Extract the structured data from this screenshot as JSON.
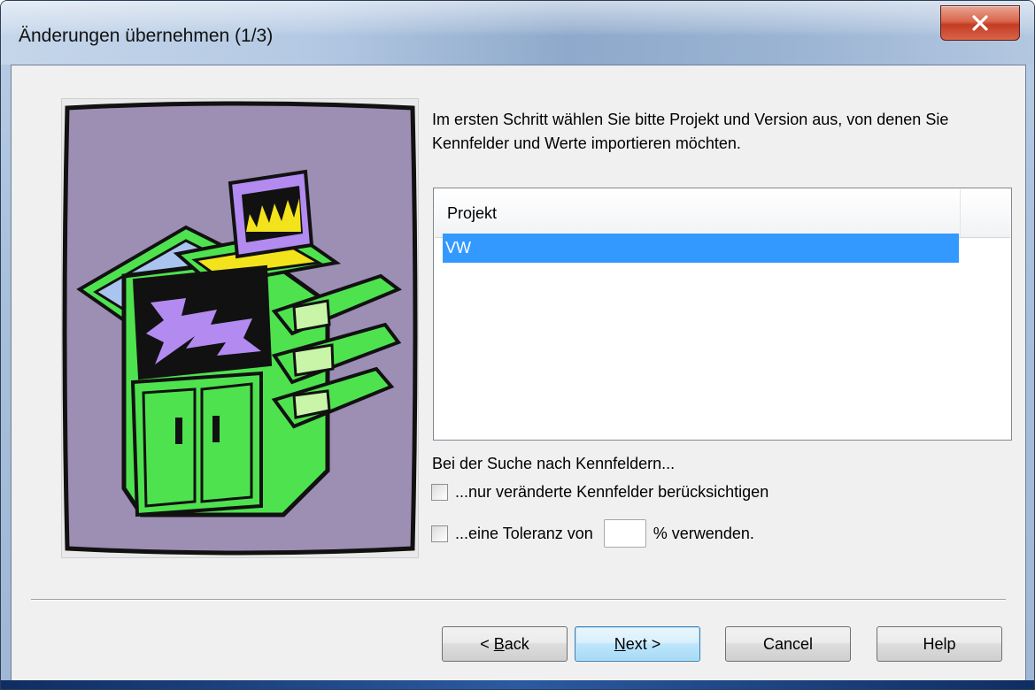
{
  "window": {
    "title": "Änderungen übernehmen (1/3)",
    "close_glyph": "x"
  },
  "instruction": "Im ersten Schritt wählen Sie bitte Projekt und Version aus, von denen Sie Kennfelder und Werte importieren möchten.",
  "project_list": {
    "column_header": "Projekt",
    "rows": [
      "VW"
    ],
    "selected_index": 0
  },
  "search": {
    "label": "Bei der Suche nach Kennfeldern...",
    "option_changed_only": {
      "label": "...nur veränderte Kennfelder berücksichtigen",
      "checked": false
    },
    "option_tolerance": {
      "label_before": "...eine Toleranz von",
      "label_after": "% verwenden.",
      "value": "",
      "checked": false
    }
  },
  "buttons": {
    "back": {
      "prefix": "< ",
      "mnemonic": "B",
      "rest": "ack"
    },
    "next": {
      "mnemonic": "N",
      "rest": "ext >"
    },
    "cancel": "Cancel",
    "help": "Help"
  },
  "colors": {
    "selection": "#3399ff",
    "illustration_bg": "#9d8eb3",
    "machine_green": "#4fe24f",
    "screen_purple": "#b28af0",
    "flame_yellow": "#f3e31c"
  },
  "illustration": {
    "icon": "printer-copier-icon"
  }
}
